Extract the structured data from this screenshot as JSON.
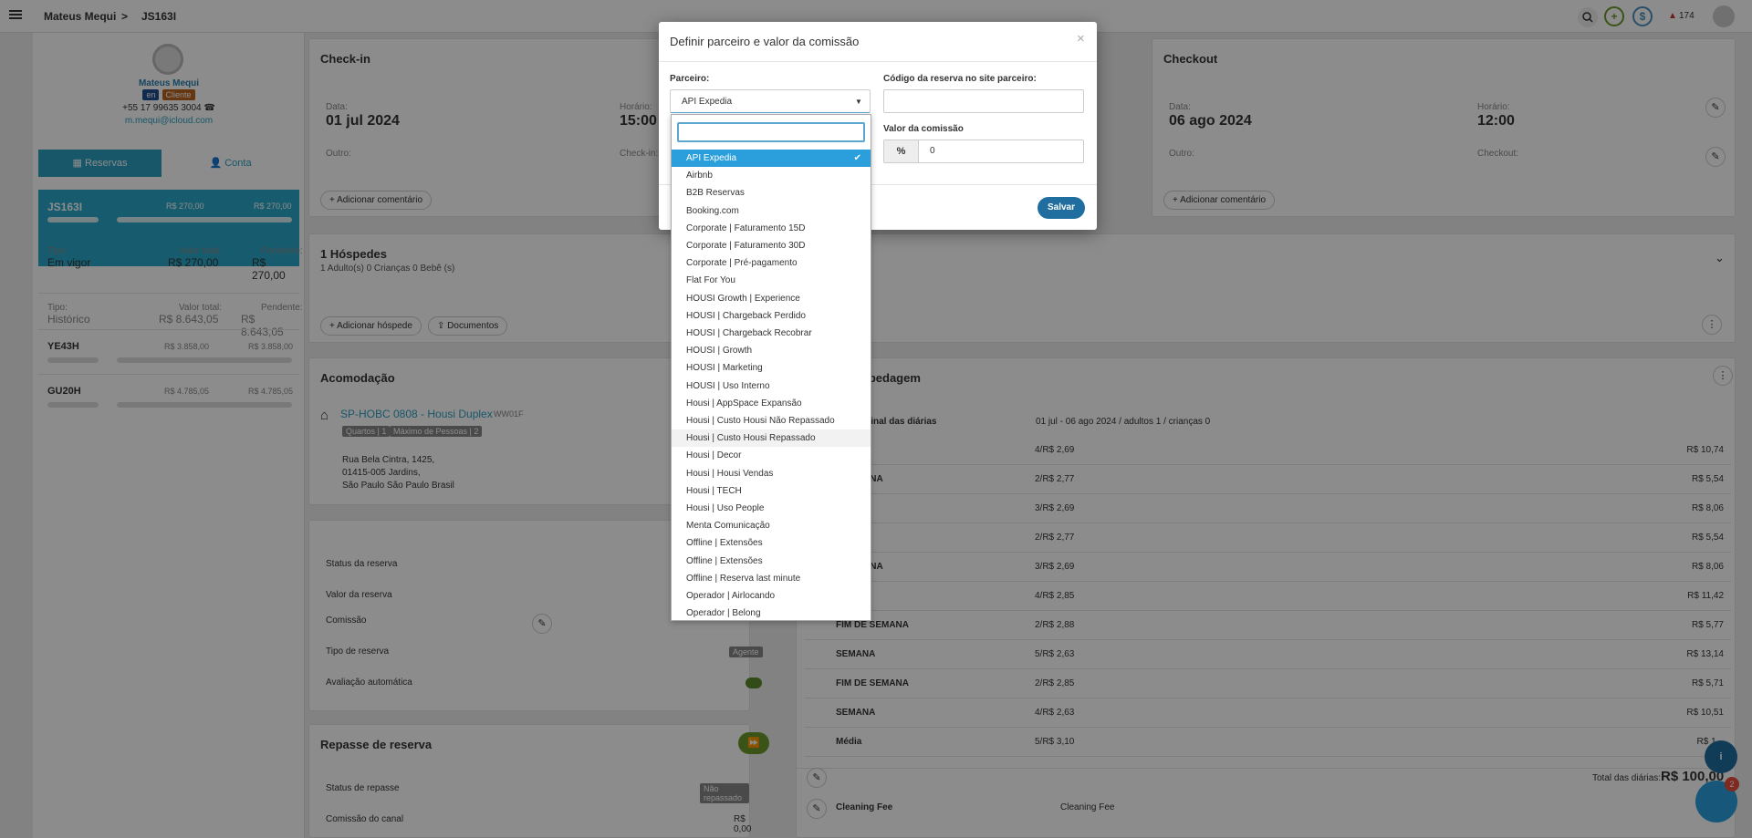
{
  "topbar": {
    "customer": "Mateus Mequi",
    "separator": ">",
    "reservation": "JS163I",
    "alerts": "174",
    "add": "+",
    "money": "$"
  },
  "guest": {
    "name": "Mateus Mequi",
    "badge_lang": "en",
    "badge_role": "Cliente",
    "phone": "+55 17 99635 3004",
    "email": "m.mequi@icloud.com"
  },
  "left_tabs": {
    "reservas": "Reservas",
    "conta": "Conta"
  },
  "reservations": {
    "current": {
      "code": "JS163I",
      "amount1": "R$ 270,00",
      "amount2": "R$ 270,00"
    },
    "vigor": {
      "tipo_label": "Tipo:",
      "tipo": "Em vigor",
      "total_label": "Valor total:",
      "total": "R$ 270,00",
      "pend_label": "Pendente:",
      "pend": "R$ 270,00"
    },
    "historico": {
      "tipo_label": "Tipo:",
      "tipo": "Histórico",
      "total_label": "Valor total:",
      "total": "R$ 8.643,05",
      "pend_label": "Pendente:",
      "pend": "R$ 8.643,05"
    },
    "others": [
      {
        "code": "YE43H",
        "a": "R$ 3.858,00",
        "b": "R$ 3.858,00"
      },
      {
        "code": "GU20H",
        "a": "R$ 4.785,05",
        "b": "R$ 4.785,05"
      }
    ]
  },
  "checkin": {
    "title": "Check-in",
    "date_label": "Data:",
    "date": "01 jul 2024",
    "time_label": "Horário:",
    "time": "15:00",
    "other_label": "Outro:",
    "in_label": "Check-in:",
    "comment_btn": "+ Adicionar comentário"
  },
  "checkout": {
    "title": "Checkout",
    "date_label": "Data:",
    "date": "06 ago 2024",
    "time_label": "Horário:",
    "time": "12:00",
    "other_label": "Outro:",
    "out_label": "Checkout:",
    "comment_btn": "+ Adicionar comentário"
  },
  "guests": {
    "title": "1 Hóspedes",
    "summary": "1 Adulto(s) 0 Crianças 0 Bebê (s)",
    "add_btn": "+ Adicionar hóspede",
    "docs_btn": "Documentos"
  },
  "accommodation": {
    "title": "Acomodação",
    "unit": "SP-HOBC 0808 - Housi Duplex",
    "code": "WW01F",
    "tag1": "Quartos | 1",
    "tag2": "Máximo de Pessoas | 2",
    "addr1": "Rua Bela Cintra, 1425,",
    "addr2": "01415-005 Jardins,",
    "addr3": "São Paulo São Paulo Brasil"
  },
  "details": {
    "status_label": "Status da reserva",
    "valor_label": "Valor da reserva",
    "comissao_label": "Comissão",
    "tipo_label": "Tipo de reserva",
    "tipo_value": "Agente",
    "aval_label": "Avaliação automática"
  },
  "repasse": {
    "title": "Repasse de reserva",
    "status_label": "Status de repasse",
    "status_value": "Não repassado",
    "comissao_label": "Comissão do canal",
    "comissao_value": "R$ 0,00"
  },
  "stay": {
    "title": "Hospedagem",
    "title_prefix": "...pedagem",
    "orig_label": "...iginal das diárias",
    "orig_value": "01 jul - 06 ago 2024  /  adultos 1  /  crianças 0",
    "rows": [
      {
        "name": "",
        "qty": "4/R$ 2,69",
        "total": "R$ 10,74"
      },
      {
        "name": "...SEMANA",
        "qty": "2/R$ 2,77",
        "total": "R$ 5,54"
      },
      {
        "name": "",
        "qty": "3/R$ 2,69",
        "total": "R$ 8,06"
      },
      {
        "name": "",
        "qty": "2/R$ 2,77",
        "total": "R$ 5,54"
      },
      {
        "name": "...SEMANA",
        "qty": "3/R$ 2,69",
        "total": "R$ 8,06"
      },
      {
        "name": "",
        "qty": "4/R$ 2,85",
        "total": "R$ 11,42"
      },
      {
        "name": "FIM DE SEMANA",
        "qty": "2/R$ 2,88",
        "total": "R$ 5,77"
      },
      {
        "name": "SEMANA",
        "qty": "5/R$ 2,63",
        "total": "R$ 13,14"
      },
      {
        "name": "FIM DE SEMANA",
        "qty": "2/R$ 2,85",
        "total": "R$ 5,71"
      },
      {
        "name": "SEMANA",
        "qty": "4/R$ 2,63",
        "total": "R$ 10,51"
      },
      {
        "name": "Média",
        "qty": "5/R$ 3,10",
        "total": "R$ 1..."
      }
    ],
    "total_label": "Total das diárias:",
    "total_value": "R$ 100,00",
    "fee_name": "Cleaning Fee",
    "fee_desc": "Cleaning Fee",
    "chat_count": "2"
  },
  "modal": {
    "title": "Definir parceiro e valor da comissão",
    "close": "×",
    "partner_label": "Parceiro:",
    "partner_value": "API Expedia",
    "code_label": "Código da reserva no site parceiro:",
    "code_value": "",
    "commission_label": "Valor da comissão",
    "commission_unit": "%",
    "commission_value": "0",
    "save": "Salvar"
  },
  "dropdown": {
    "search_value": "",
    "options": [
      "API Expedia",
      "Airbnb",
      "B2B Reservas",
      "Booking.com",
      "Corporate | Faturamento 15D",
      "Corporate | Faturamento 30D",
      "Corporate | Pré-pagamento",
      "Flat For You",
      "HOUSI Growth | Experience",
      "HOUSI | Chargeback Perdido",
      "HOUSI | Chargeback Recobrar",
      "HOUSI | Growth",
      "HOUSI | Marketing",
      "HOUSI | Uso Interno",
      "Housi | AppSpace Expansão",
      "Housi | Custo Housi Não Repassado",
      "Housi | Custo Housi Repassado",
      "Housi | Decor",
      "Housi | Housi Vendas",
      "Housi | TECH",
      "Housi | Uso People",
      "Menta Comunicação",
      "Offline | Extensões",
      "Offline | Extensões",
      "Offline | Reserva last minute",
      "Operador | Airlocando",
      "Operador | Belong"
    ],
    "selected": "API Expedia"
  },
  "colors": {
    "accent": "#2a9fbf",
    "primary_btn": "#1f6e9f",
    "green": "#6a9a2a",
    "brown": "#b7651f"
  }
}
